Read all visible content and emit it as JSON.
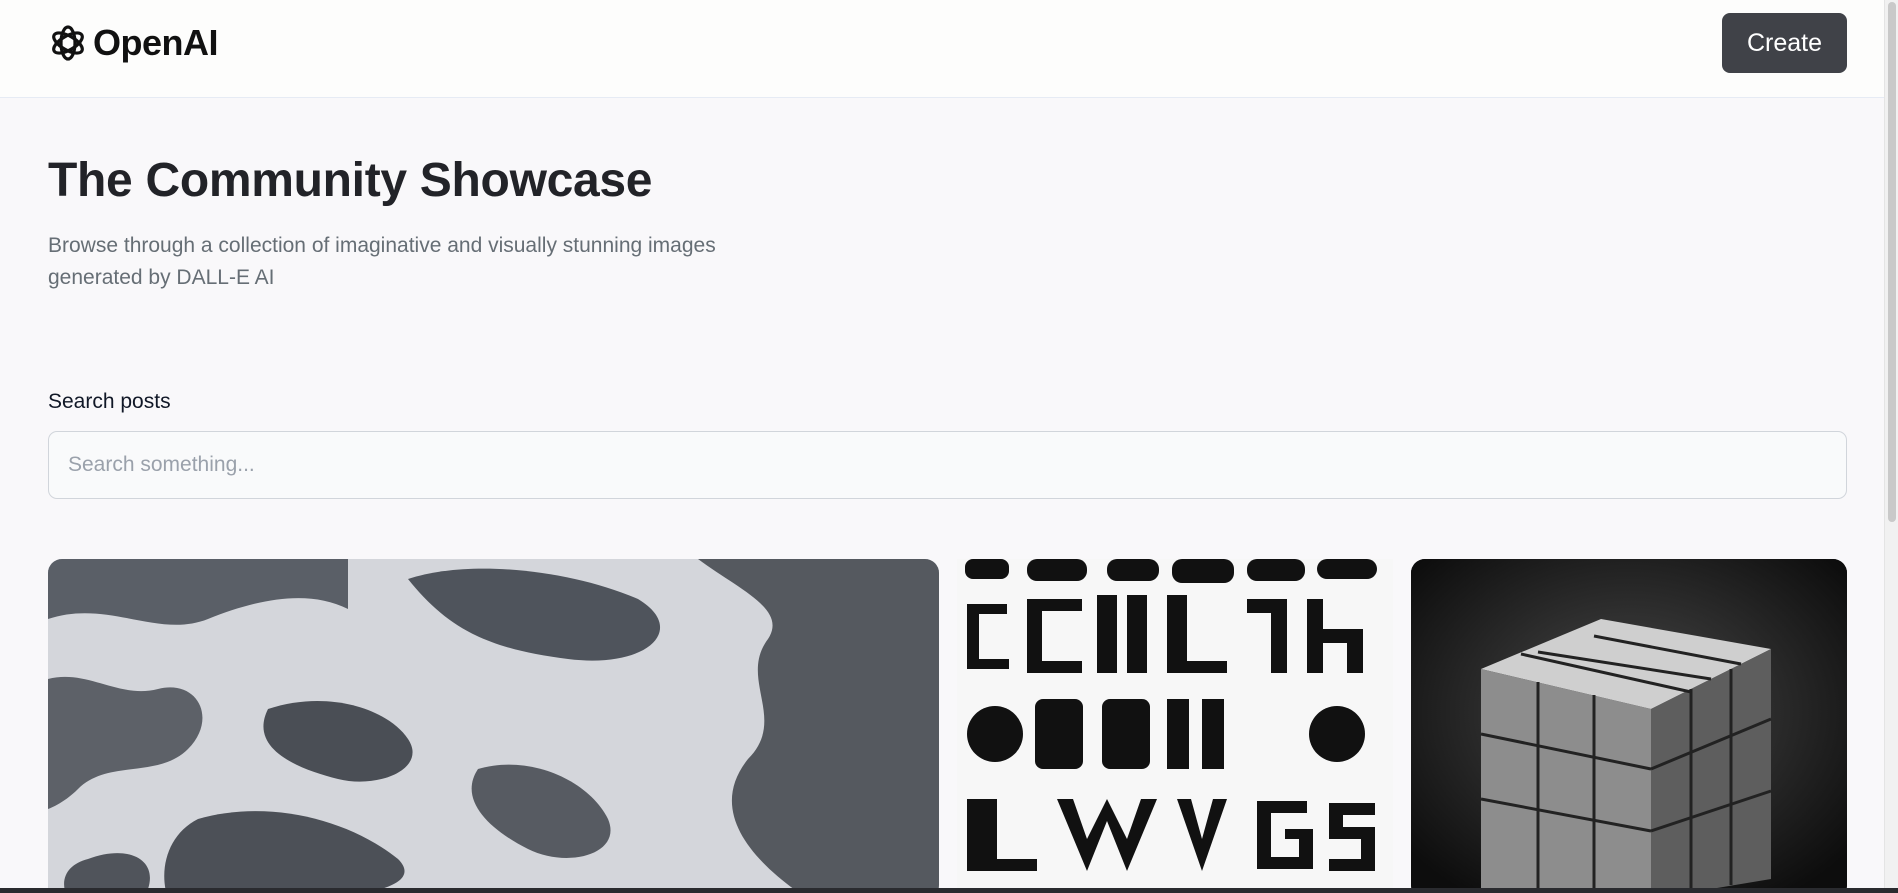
{
  "header": {
    "brand_name": "OpenAI",
    "create_label": "Create"
  },
  "hero": {
    "title": "The Community Showcase",
    "subtitle": "Browse through a collection of imaginative and visually stunning images generated by DALL-E AI"
  },
  "search": {
    "label": "Search posts",
    "placeholder": "Search something...",
    "value": ""
  },
  "gallery": {
    "cards": [
      {
        "description": "Black and white rocky shoreline with white surf"
      },
      {
        "description": "Grid of decorative blackletter-style glyphs"
      },
      {
        "description": "Stone-textured Rubik's cube on dark background"
      }
    ]
  },
  "colors": {
    "accent_button": "#404248",
    "page_bg": "#f9f8fa",
    "heading": "#222328",
    "muted_text": "#666e75"
  }
}
